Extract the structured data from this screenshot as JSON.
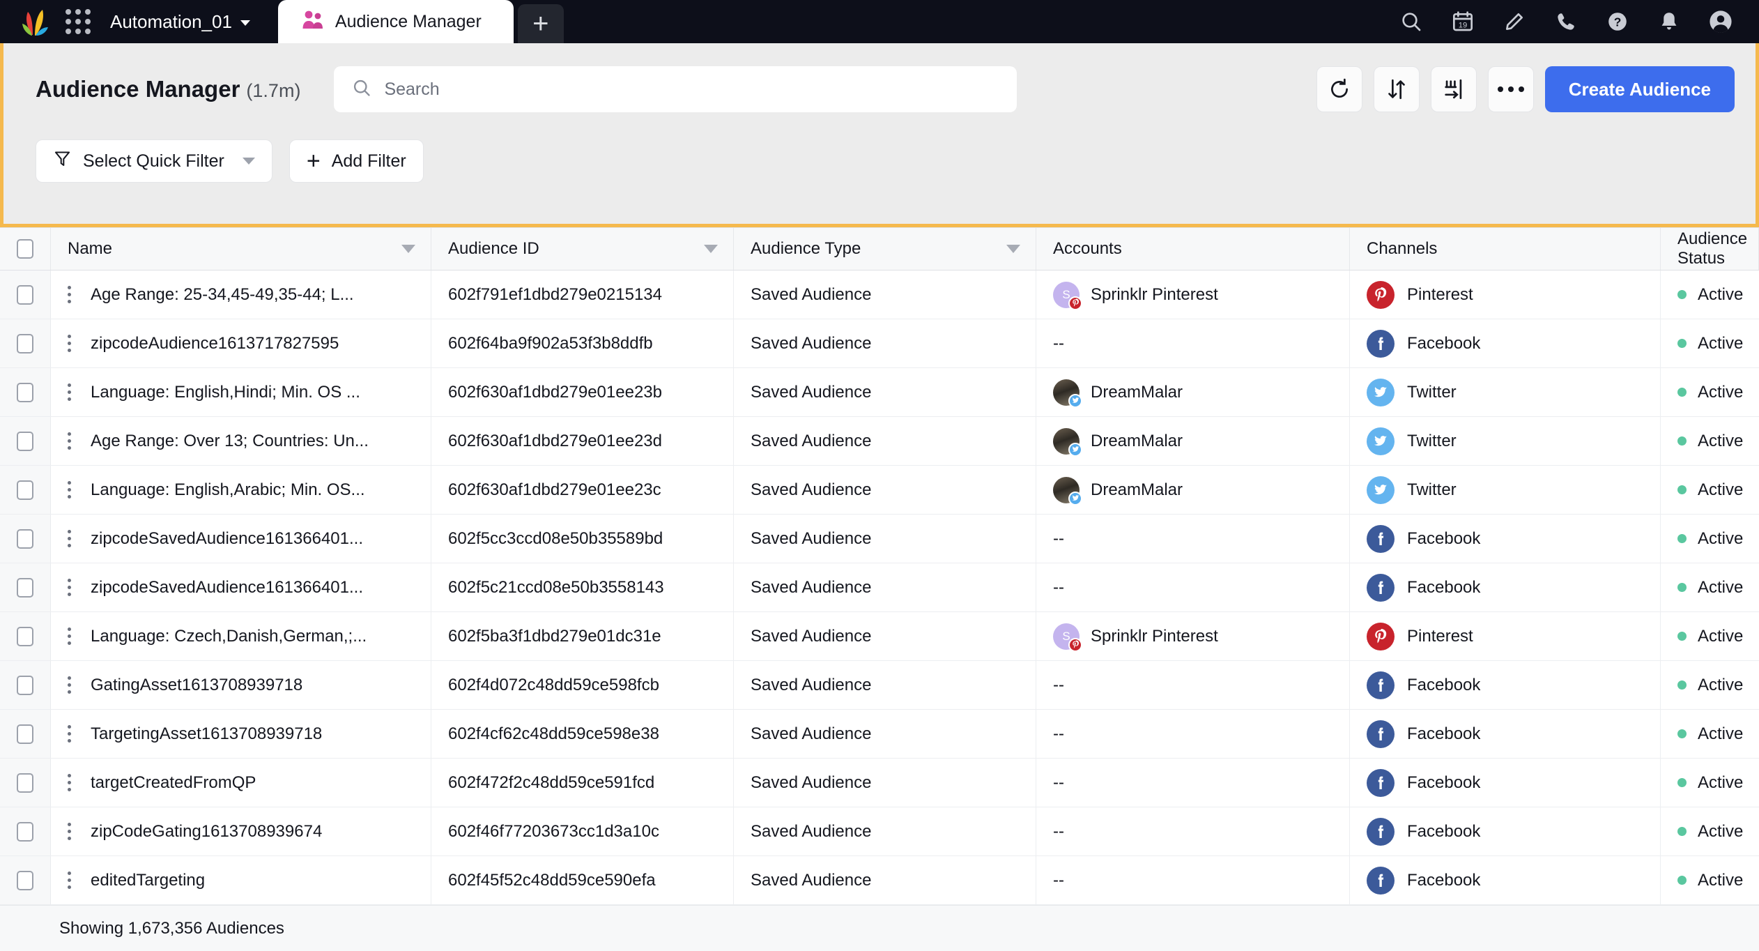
{
  "topnav": {
    "logo_name": "sprinklr-logo",
    "app_grid_label": "app-grid",
    "workspace": "Automation_01",
    "tabs": [
      {
        "label": "Audience Manager",
        "icon": "audience-icon",
        "active": true
      }
    ],
    "new_tab_label": "+",
    "right_icons": [
      {
        "name": "search-icon",
        "label": "Search"
      },
      {
        "name": "calendar-icon",
        "label": "Calendar",
        "day": "19"
      },
      {
        "name": "pencil-icon",
        "label": "Compose"
      },
      {
        "name": "phone-icon",
        "label": "Call"
      },
      {
        "name": "help-icon",
        "label": "Help"
      },
      {
        "name": "bell-icon",
        "label": "Notifications"
      },
      {
        "name": "avatar-icon",
        "label": "Profile"
      }
    ]
  },
  "header": {
    "title": "Audience Manager",
    "count": "(1.7m)",
    "accent_border": "#f5b94d",
    "search": {
      "placeholder": "Search",
      "value": ""
    },
    "actions": [
      {
        "name": "refresh-button",
        "label": "Refresh"
      },
      {
        "name": "sort-button",
        "label": "Sort"
      },
      {
        "name": "column-settings-button",
        "label": "Column Settings"
      },
      {
        "name": "more-options-button",
        "label": "More"
      }
    ],
    "create_button": {
      "label": "Create Audience",
      "color": "#3d6ded"
    },
    "filters": {
      "quick_filter_label": "Select Quick Filter",
      "add_filter_label": "Add Filter"
    }
  },
  "table": {
    "columns": [
      {
        "key": "name",
        "label": "Name",
        "sortable": true
      },
      {
        "key": "id",
        "label": "Audience ID",
        "sortable": true
      },
      {
        "key": "type",
        "label": "Audience Type",
        "sortable": true
      },
      {
        "key": "account",
        "label": "Accounts",
        "sortable": false
      },
      {
        "key": "channel",
        "label": "Channels",
        "sortable": false
      },
      {
        "key": "status",
        "label": "Audience Status",
        "sortable": false
      }
    ],
    "rows": [
      {
        "name": "Age Range: 25-34,45-49,35-44; L...",
        "id": "602f791ef1dbd279e0215134",
        "type": "Saved Audience",
        "account": "Sprinklr Pinterest",
        "account_kind": "purple-s",
        "account_badge": "pinterest",
        "channel": "Pinterest",
        "channel_kind": "pinterest",
        "status": "Active"
      },
      {
        "name": "zipcodeAudience1613717827595",
        "id": "602f64ba9f902a53f3b8ddfb",
        "type": "Saved Audience",
        "account": "--",
        "account_kind": "none",
        "account_badge": "",
        "channel": "Facebook",
        "channel_kind": "facebook",
        "status": "Active"
      },
      {
        "name": "Language: English,Hindi; Min. OS ...",
        "id": "602f630af1dbd279e01ee23b",
        "type": "Saved Audience",
        "account": "DreamMalar",
        "account_kind": "photo",
        "account_badge": "twitter",
        "channel": "Twitter",
        "channel_kind": "twitter",
        "status": "Active"
      },
      {
        "name": "Age Range: Over 13; Countries: Un...",
        "id": "602f630af1dbd279e01ee23d",
        "type": "Saved Audience",
        "account": "DreamMalar",
        "account_kind": "photo",
        "account_badge": "twitter",
        "channel": "Twitter",
        "channel_kind": "twitter",
        "status": "Active"
      },
      {
        "name": "Language: English,Arabic; Min. OS...",
        "id": "602f630af1dbd279e01ee23c",
        "type": "Saved Audience",
        "account": "DreamMalar",
        "account_kind": "photo",
        "account_badge": "twitter",
        "channel": "Twitter",
        "channel_kind": "twitter",
        "status": "Active"
      },
      {
        "name": "zipcodeSavedAudience161366401...",
        "id": "602f5cc3ccd08e50b35589bd",
        "type": "Saved Audience",
        "account": "--",
        "account_kind": "none",
        "account_badge": "",
        "channel": "Facebook",
        "channel_kind": "facebook",
        "status": "Active"
      },
      {
        "name": "zipcodeSavedAudience161366401...",
        "id": "602f5c21ccd08e50b3558143",
        "type": "Saved Audience",
        "account": "--",
        "account_kind": "none",
        "account_badge": "",
        "channel": "Facebook",
        "channel_kind": "facebook",
        "status": "Active"
      },
      {
        "name": "Language: Czech,Danish,German,;...",
        "id": "602f5ba3f1dbd279e01dc31e",
        "type": "Saved Audience",
        "account": "Sprinklr Pinterest",
        "account_kind": "purple-s",
        "account_badge": "pinterest",
        "channel": "Pinterest",
        "channel_kind": "pinterest",
        "status": "Active"
      },
      {
        "name": "GatingAsset1613708939718",
        "id": "602f4d072c48dd59ce598fcb",
        "type": "Saved Audience",
        "account": "--",
        "account_kind": "none",
        "account_badge": "",
        "channel": "Facebook",
        "channel_kind": "facebook",
        "status": "Active"
      },
      {
        "name": "TargetingAsset1613708939718",
        "id": "602f4cf62c48dd59ce598e38",
        "type": "Saved Audience",
        "account": "--",
        "account_kind": "none",
        "account_badge": "",
        "channel": "Facebook",
        "channel_kind": "facebook",
        "status": "Active"
      },
      {
        "name": "targetCreatedFromQP",
        "id": "602f472f2c48dd59ce591fcd",
        "type": "Saved Audience",
        "account": "--",
        "account_kind": "none",
        "account_badge": "",
        "channel": "Facebook",
        "channel_kind": "facebook",
        "status": "Active"
      },
      {
        "name": "zipCodeGating1613708939674",
        "id": "602f46f77203673cc1d3a10c",
        "type": "Saved Audience",
        "account": "--",
        "account_kind": "none",
        "account_badge": "",
        "channel": "Facebook",
        "channel_kind": "facebook",
        "status": "Active"
      },
      {
        "name": "editedTargeting",
        "id": "602f45f52c48dd59ce590efa",
        "type": "Saved Audience",
        "account": "--",
        "account_kind": "none",
        "account_badge": "",
        "channel": "Facebook",
        "channel_kind": "facebook",
        "status": "Active"
      }
    ],
    "footer": "Showing 1,673,356 Audiences",
    "status_color": "#5ac79f"
  }
}
